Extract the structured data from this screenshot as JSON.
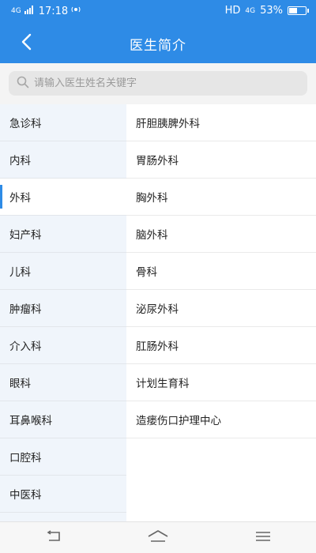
{
  "status_bar": {
    "network_left": "4G",
    "time": "17:18",
    "hd": "HD",
    "network_right": "4G",
    "battery_text": "53%",
    "battery_level": 0.53
  },
  "header": {
    "title": "医生简介",
    "back_icon": "back-arrow-icon"
  },
  "search": {
    "placeholder": "请输入医生姓名关键字",
    "value": "",
    "icon": "search-icon"
  },
  "departments": [
    {
      "label": "急诊科",
      "active": false
    },
    {
      "label": "内科",
      "active": false
    },
    {
      "label": "外科",
      "active": true
    },
    {
      "label": "妇产科",
      "active": false
    },
    {
      "label": "儿科",
      "active": false
    },
    {
      "label": "肿瘤科",
      "active": false
    },
    {
      "label": "介入科",
      "active": false
    },
    {
      "label": "眼科",
      "active": false
    },
    {
      "label": "耳鼻喉科",
      "active": false
    },
    {
      "label": "口腔科",
      "active": false
    },
    {
      "label": "中医科",
      "active": false
    }
  ],
  "sub_departments": [
    {
      "label": "肝胆胰脾外科"
    },
    {
      "label": "胃肠外科"
    },
    {
      "label": "胸外科"
    },
    {
      "label": "脑外科"
    },
    {
      "label": "骨科"
    },
    {
      "label": "泌尿外科"
    },
    {
      "label": "肛肠外科"
    },
    {
      "label": "计划生育科"
    },
    {
      "label": "造瘘伤口护理中心"
    }
  ],
  "colors": {
    "accent": "#2e8be6",
    "left_panel": "#f0f5fb"
  },
  "bottom_nav": {
    "back_icon": "system-back-icon",
    "home_icon": "system-home-icon",
    "menu_icon": "system-menu-icon"
  }
}
